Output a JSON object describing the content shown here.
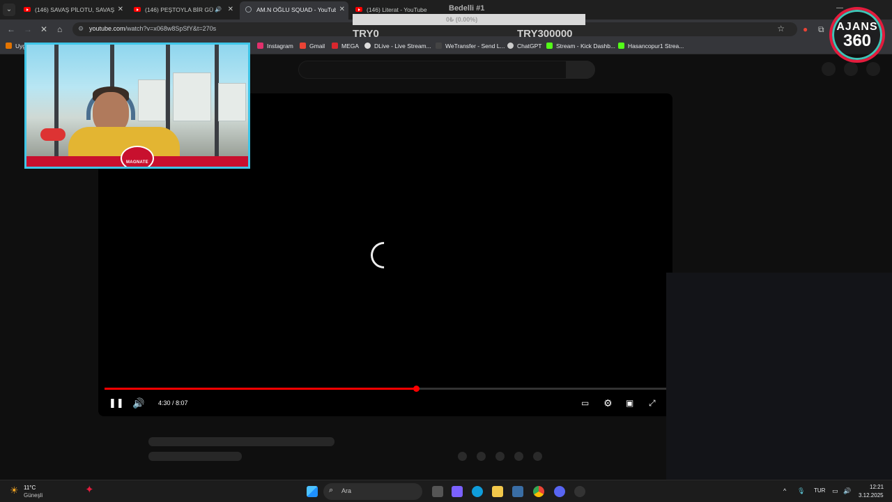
{
  "browser": {
    "tabs": [
      {
        "title": "(146) SAVAŞ PİLOTU, SAVAŞ UÇ",
        "active": false
      },
      {
        "title": "(146) PEŞTOYLA BİR GÜN G",
        "active": false
      },
      {
        "title": "AM.N OĞLU SQUAD - YouTube",
        "active": true
      },
      {
        "title": "(146) Literat - YouTube",
        "active": false
      }
    ],
    "url_host": "youtube.com",
    "url_path": "/watch?v=x068w8SpSfY&t=270s",
    "bookmarks": [
      {
        "label": "Uyg",
        "icon": "apps-grid-icon",
        "color": "#e37400"
      },
      {
        "label": "Instagram",
        "icon": "instagram-icon",
        "color": "#e1306c"
      },
      {
        "label": "Gmail",
        "icon": "gmail-icon",
        "color": "#ea4335"
      },
      {
        "label": "MEGA",
        "icon": "mega-icon",
        "color": "#d9272e"
      },
      {
        "label": "DLive - Live Stream...",
        "icon": "dlive-icon",
        "color": "#dddddd"
      },
      {
        "label": "WeTransfer - Send L...",
        "icon": "wetransfer-icon",
        "color": "#222222"
      },
      {
        "label": "ChatGPT",
        "icon": "chatgpt-icon",
        "color": "#cccccc"
      },
      {
        "label": "Stream - Kick Dashb...",
        "icon": "kick-icon",
        "color": "#53fc18"
      },
      {
        "label": "Hasancopur1 Strea...",
        "icon": "kick-icon",
        "color": "#53fc18"
      }
    ]
  },
  "player": {
    "current_time": "4:30",
    "duration": "8:07",
    "time_display": "4:30 / 8:07",
    "progress": 0.554,
    "loading": true
  },
  "overlay": {
    "donation_title": "Bedelli #1",
    "donation_percent": "0₺ (0.00%)",
    "donation_min": "TRY0",
    "donation_max": "TRY300000",
    "logo_line1": "AJANS",
    "logo_line2": "360",
    "webcam_badge": "MAGNATE"
  },
  "taskbar": {
    "weather_temp": "11°C",
    "weather_desc": "Güneşli",
    "search_placeholder": "Ara",
    "language": "TUR",
    "time": "12:21",
    "date": "3.12.2025"
  }
}
